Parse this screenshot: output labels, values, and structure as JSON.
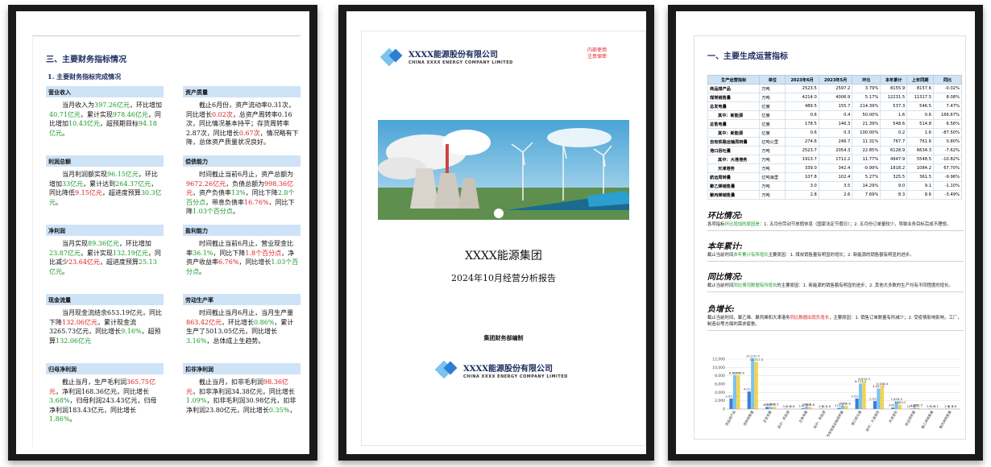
{
  "page1": {
    "section_title": "三、主要财务指标情况",
    "sub_title": "1. 主要财务指标完成情况",
    "cells": [
      {
        "head": "营业收入",
        "parts": [
          [
            "",
            "当月收入为"
          ],
          [
            "g",
            "397.26亿元"
          ],
          [
            "",
            "，环比增加"
          ],
          [
            "g",
            "40.71亿元"
          ],
          [
            "",
            "，累计实现"
          ],
          [
            "g",
            "978.46亿元"
          ],
          [
            "",
            "，同比增加"
          ],
          [
            "g",
            "10.43亿元"
          ],
          [
            "",
            "，超预期目标"
          ],
          [
            "g",
            "94.18亿元"
          ],
          [
            "",
            "。"
          ]
        ]
      },
      {
        "head": "资产质量",
        "parts": [
          [
            "",
            "截止6月份，资产流动率0.31次，同比增长"
          ],
          [
            "r",
            "0.02次"
          ],
          [
            "",
            "，总资产周转率0.16次，同比情况基本持平；存货周转率2.87次，同比增长"
          ],
          [
            "r",
            "0.67次"
          ],
          [
            "",
            "，情况略有下降，总体资产质量状况良好。"
          ]
        ]
      },
      {
        "head": "利润总额",
        "parts": [
          [
            "",
            "当月利润额实现"
          ],
          [
            "g",
            "96.15亿元"
          ],
          [
            "",
            "，环比增加"
          ],
          [
            "g",
            "33亿元"
          ],
          [
            "",
            "，累计达到"
          ],
          [
            "g",
            "264.37亿元"
          ],
          [
            "",
            "，同比降低"
          ],
          [
            "r",
            "9.15亿元"
          ],
          [
            "",
            "，超进度预算"
          ],
          [
            "g",
            "30.3亿元"
          ],
          [
            "",
            "。"
          ]
        ]
      },
      {
        "head": "偿债能力",
        "parts": [
          [
            "",
            "时间截止当前6月止，资产总额为"
          ],
          [
            "r",
            "9672.26亿元"
          ],
          [
            "",
            "，负债总额为"
          ],
          [
            "r",
            "998.36亿元"
          ],
          [
            "",
            "，资产负债率"
          ],
          [
            "g",
            "13%"
          ],
          [
            "",
            "，同比下降"
          ],
          [
            "g",
            "2.8个百分点"
          ],
          [
            "",
            "，带息负债率"
          ],
          [
            "r",
            "16.76%"
          ],
          [
            "",
            "，同比下降"
          ],
          [
            "g",
            "1.03个百分点"
          ],
          [
            "",
            "。"
          ]
        ]
      },
      {
        "head": "净利润",
        "parts": [
          [
            "",
            "当月实现"
          ],
          [
            "g",
            "89.36亿元"
          ],
          [
            "",
            "，环比增加"
          ],
          [
            "g",
            "23.87亿元"
          ],
          [
            "",
            "，累计实现"
          ],
          [
            "g",
            "132.19亿元"
          ],
          [
            "",
            "，同比减少"
          ],
          [
            "r",
            "23.64亿元"
          ],
          [
            "",
            "，超进度预算"
          ],
          [
            "g",
            "25.13亿元"
          ],
          [
            "",
            "。"
          ]
        ]
      },
      {
        "head": "盈利能力",
        "parts": [
          [
            "",
            "时间截止当前6月止，营业现金比率"
          ],
          [
            "g",
            "36.1%"
          ],
          [
            "",
            "，同比下降"
          ],
          [
            "r",
            "1.8个百分点"
          ],
          [
            "",
            "，净资产收益率"
          ],
          [
            "r",
            "6.76%"
          ],
          [
            "",
            "，同比增长"
          ],
          [
            "g",
            "1.03个百分点"
          ],
          [
            "",
            "。"
          ]
        ]
      },
      {
        "head": "现金流量",
        "parts": [
          [
            "",
            "当月现金流结余653.19亿元，同比下降"
          ],
          [
            "r",
            "132.06亿元"
          ],
          [
            "",
            "，累计现金流3265.73亿元，同比增长"
          ],
          [
            "g",
            "9.16%"
          ],
          [
            "",
            "，超预算"
          ],
          [
            "g",
            "132.06亿元"
          ]
        ]
      },
      {
        "head": "劳动生产率",
        "parts": [
          [
            "",
            "时间截止当月6月止，当月生产量"
          ],
          [
            "r",
            "863.42亿元"
          ],
          [
            "",
            "，环比增长"
          ],
          [
            "g",
            "0.86%"
          ],
          [
            "",
            "，累计生产了5013.05亿元，同比增长"
          ],
          [
            "g",
            "3.16%"
          ],
          [
            "",
            "，总体成上生趋势。"
          ]
        ]
      },
      {
        "head": "归母净利润",
        "parts": [
          [
            "",
            "截止当月，生产毛利润"
          ],
          [
            "r",
            "365.75亿元"
          ],
          [
            "",
            "，净利润168.36亿元，同比增长"
          ],
          [
            "g",
            "3.68%"
          ],
          [
            "",
            "，归母利润243.43亿元，归母净利润183.43亿元，同比增长"
          ],
          [
            "g",
            "1.86%"
          ],
          [
            "",
            "。"
          ]
        ]
      },
      {
        "head": "扣非净利润",
        "parts": [
          [
            "",
            "截止当月，扣非毛利润"
          ],
          [
            "r",
            "98.36亿元"
          ],
          [
            "",
            "，扣非净利润34.38亿元，同比增长"
          ],
          [
            "g",
            "1.09%"
          ],
          [
            "",
            "，扣非毛利润30.98亿元，扣非净利润23.80亿元，同比增长"
          ],
          [
            "g",
            "0.35%"
          ],
          [
            "",
            "，"
          ]
        ]
      }
    ]
  },
  "page2": {
    "company_cn": "XXXX能源股份有限公司",
    "company_en": "CHINA  XXXX ENERGY COMPANY LIMITED",
    "stamp_line1": "内部使用",
    "stamp_line2": "注意保密",
    "group_name": "XXXX能源集团",
    "report_title": "2024年10月经营分析报告",
    "compiled_by": "集团财务部编制",
    "bottom_company_cn": "XXXX能源股份有限公司",
    "bottom_company_en": "CHINA  XXXX ENERGY COMPANY LIMITED",
    "colors": {
      "logo_blue": "#2d7fd3",
      "logo_light": "#7cc3ef"
    }
  },
  "page3": {
    "section_title": "一、主要生成运营指标",
    "table": {
      "headers": [
        "生产运营指标",
        "单位",
        "2023年6月",
        "2023年5月",
        "环比",
        "本年累计",
        "上年同期",
        "同比"
      ],
      "rows": [
        [
          "商品煤产品",
          "万吨",
          "2523.5",
          "2597.2",
          "3.79%",
          "8155.9",
          "8157.6",
          "-0.02%"
        ],
        [
          "煤炭销售量",
          "万吨",
          "4214.0",
          "4006.9",
          "5.17%",
          "12231.5",
          "11317.5",
          "8.08%"
        ],
        [
          "总发电量",
          "亿度",
          "489.5",
          "155.7",
          "214.39%",
          "537.3",
          "546.5",
          "7.47%"
        ],
        [
          "其中：新能源",
          "亿度",
          "0.6",
          "0.4",
          "50.00%",
          "1.6",
          "0.6",
          "166.67%"
        ],
        [
          "总售电量",
          "亿度",
          "178.5",
          "146.3",
          "21.39%",
          "548.6",
          "514.8",
          "6.56%"
        ],
        [
          "其中：新能源",
          "亿度",
          "0.6",
          "0.3",
          "100.00%",
          "0.2",
          "1.6",
          "-87.50%"
        ],
        [
          "自有铁路运输周转量",
          "亿吨公里",
          "274.6",
          "246.7",
          "11.31%",
          "767.7",
          "761.6",
          "0.80%"
        ],
        [
          "港口吞吐量",
          "万吨",
          "2523.7",
          "2054.3",
          "22.85%",
          "6128.9",
          "6634.3",
          "-7.62%"
        ],
        [
          "其中：大港港务",
          "万吨",
          "1913.7",
          "1712.2",
          "11.77%",
          "4947.9",
          "5548.5",
          "-10.82%"
        ],
        [
          "天津港务",
          "万吨",
          "339.0",
          "342.4",
          "-0.99%",
          "1818.2",
          "1084.2",
          "67.70%"
        ],
        [
          "航运周转量",
          "亿吨海里",
          "107.8",
          "102.4",
          "5.27%",
          "325.5",
          "361.5",
          "-9.96%"
        ],
        [
          "聚乙烯销售量",
          "万吨",
          "3.0",
          "3.5",
          "14.29%",
          "9.0",
          "9.1",
          "-1.10%"
        ],
        [
          "聚丙烯销售量",
          "万吨",
          "2.8",
          "2.6",
          "7.69%",
          "8.3",
          "8.6",
          "-3.49%"
        ]
      ],
      "indented_rows": [
        3,
        5,
        8,
        9
      ]
    },
    "sections": [
      {
        "title": "环比情况:",
        "parts": [
          [
            "",
            "各项指标"
          ],
          [
            "g",
            "环比增加的原因是"
          ],
          [
            "",
            "：1. 五月份劳动节放假休息（国家法定节假日）；2. 五月份订单量较少，导致业务目标完成不理想。"
          ]
        ]
      },
      {
        "title": "本年累计:",
        "parts": [
          [
            "",
            "截止当前时间"
          ],
          [
            "g",
            "本年累计有所增长"
          ],
          [
            "",
            "主要原因：1. 煤炭销售量有明显的增长；2. 新能源的销售额有明显的进步。"
          ]
        ]
      },
      {
        "title": "同比情况:",
        "parts": [
          [
            "",
            "截止当前时间"
          ],
          [
            "g",
            "同比情况数据有所增长"
          ],
          [
            "",
            "的主要原因：1. 新能源的销售额有明显的进步；2. 其他大多数的生产均有不同程度的增长。"
          ]
        ]
      },
      {
        "title": "负增长:",
        "parts": [
          [
            "",
            "截止当前时间，聚乙烯、聚丙烯和大津港务"
          ],
          [
            "r",
            "同比数据出现负增长"
          ],
          [
            "",
            "，主要原因：1. 销售订单数量有所减少；2. 受疫情影响影响，工厂，制造业等方面的需求疲惫。"
          ]
        ]
      }
    ]
  },
  "chart_data": {
    "type": "bar",
    "categories": [
      "商品煤产品",
      "煤炭销售量",
      "总发电量",
      "其中：新能源",
      "总售电量",
      "其中：新能源",
      "自有铁路运输周转量",
      "港口吞吐量",
      "其中：大港港务",
      "天津港务",
      "航运周转量",
      "聚乙烯销售量",
      "聚丙烯销售量"
    ],
    "series": [
      {
        "values": [
          2523.5,
          4214.0,
          489.5,
          0.6,
          178.5,
          0.6,
          274.6,
          2523.7,
          1913.7,
          339.0,
          107.8,
          3.0,
          2.8
        ],
        "color": "#3a7fd5"
      },
      {
        "values": [
          8155.9,
          12231.5,
          537.3,
          1.6,
          548.6,
          0.2,
          767.7,
          6128.9,
          4947.9,
          1818.2,
          325.5,
          9.0,
          8.3
        ],
        "color": "#7cc3ef"
      },
      {
        "values": [
          8157.6,
          11317.5,
          546.5,
          0.6,
          514.8,
          1.6,
          761.6,
          6634.3,
          5548.5,
          1084.2,
          361.5,
          9.1,
          8.6
        ],
        "color": "#f5d34a"
      }
    ],
    "data_labels": [
      [
        "2,523.5",
        "4,214.0",
        "489.5",
        "0.6",
        "178.5",
        "0.6",
        "274.6",
        "2,523.7",
        "1,913.7",
        "339.0",
        "107.8",
        "3.0",
        "2.8"
      ],
      [
        "8,155.9",
        "12,231.5",
        "537.3",
        "1.6",
        "548.6",
        "0.2",
        "767.7",
        "6,128.9",
        "4,947.9",
        "1,818.2",
        "325.5",
        "9.0",
        "8.3"
      ],
      [
        "8,157.6",
        "11,317.5",
        "546.5",
        "0.6",
        "514.8",
        "1.6",
        "761.6",
        "6,634.3",
        "5,548.5",
        "1,084.2",
        "361.5",
        "9.1",
        "8.6"
      ]
    ],
    "ylim": [
      0,
      12000
    ],
    "yticks": [
      "0",
      "2,000",
      "4,000",
      "6,000",
      "8,000",
      "10,000",
      "12,000"
    ],
    "grid": true
  }
}
